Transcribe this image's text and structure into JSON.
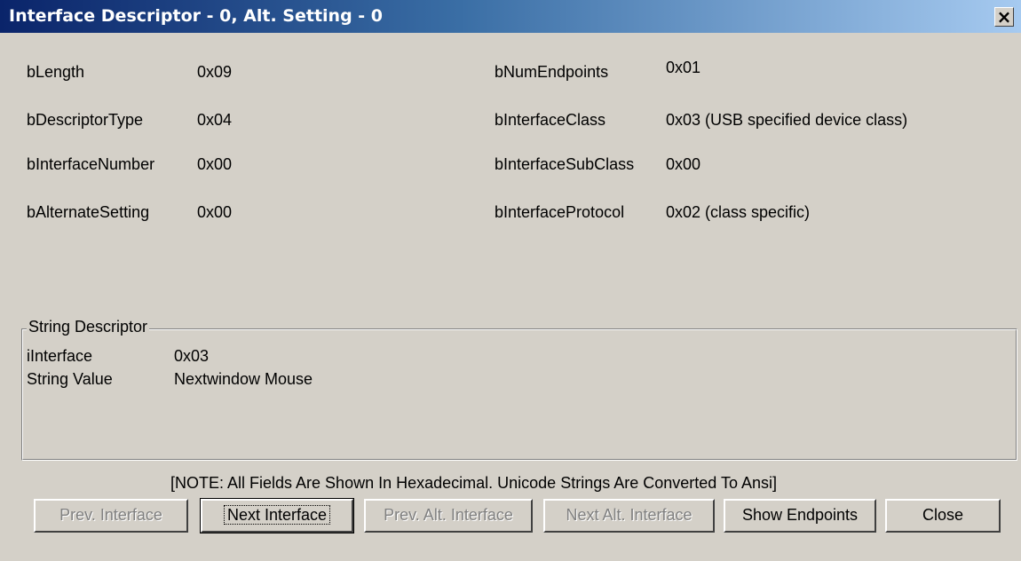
{
  "window": {
    "title": "Interface Descriptor - 0, Alt. Setting - 0",
    "close_glyph": "×",
    "close_icon": "close-icon"
  },
  "fields_left": [
    {
      "label": "bLength",
      "value": "0x09"
    },
    {
      "label": "bDescriptorType",
      "value": "0x04"
    },
    {
      "label": "bInterfaceNumber",
      "value": "0x00"
    },
    {
      "label": "bAlternateSetting",
      "value": "0x00"
    }
  ],
  "fields_right": [
    {
      "label": "bNumEndpoints",
      "value": "0x01"
    },
    {
      "label": "bInterfaceClass",
      "value": "0x03 (USB specified device class)"
    },
    {
      "label": "bInterfaceSubClass",
      "value": "0x00"
    },
    {
      "label": "bInterfaceProtocol",
      "value": "0x02 (class specific)"
    }
  ],
  "string_descriptor": {
    "title": "String Descriptor",
    "rows": [
      {
        "label": "iInterface",
        "value": "0x03"
      },
      {
        "label": "String Value",
        "value": "Nextwindow Mouse"
      }
    ]
  },
  "note": "[NOTE: All Fields Are Shown In Hexadecimal.   Unicode Strings Are Converted To Ansi]",
  "buttons": {
    "prev_interface": "Prev. Interface",
    "next_interface": "Next Interface",
    "prev_alt_interface": "Prev. Alt. Interface",
    "next_alt_interface": "Next Alt. Interface",
    "show_endpoints": "Show Endpoints",
    "close": "Close"
  }
}
